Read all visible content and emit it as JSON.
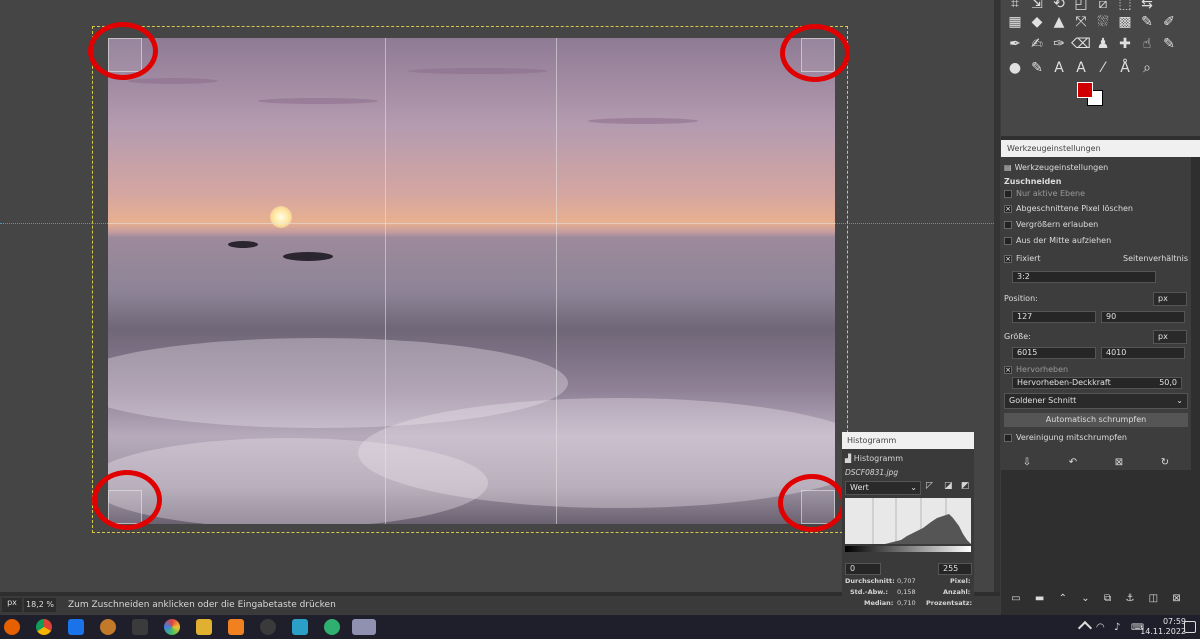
{
  "statusbar": {
    "unit": "px",
    "zoom": "18,2 %",
    "message": "Zum Zuschneiden anklicken oder die Eingabetaste drücken"
  },
  "tool_options": {
    "window_title": "Werkzeugeinstellungen",
    "tab_label": "Werkzeugeinstellungen",
    "section": "Zuschneiden",
    "only_active_layer": "Nur aktive Ebene",
    "delete_cropped": "Abgeschnittene Pixel löschen",
    "allow_growing": "Vergrößern erlauben",
    "expand_from_center": "Aus der Mitte aufziehen",
    "fixed_label": "Fixiert",
    "fixed_mode": "Seitenverhältnis",
    "ratio_value": "3:2",
    "position_label": "Position:",
    "position_unit": "px",
    "position_x": "127",
    "position_y": "90",
    "size_label": "Größe:",
    "size_unit": "px",
    "size_w": "6015",
    "size_h": "4010",
    "highlight": "Hervorheben",
    "highlight_opacity": "Hervorheben-Deckkraft",
    "highlight_value": "50,0",
    "guides_value": "Goldener Schnitt",
    "auto_shrink": "Automatisch schrumpfen",
    "shrink_merged": "Vereinigung mitschrumpfen"
  },
  "histogram": {
    "window_title": "Histogramm",
    "tab_label": "Histogramm",
    "filename": "DSCF0831.jpg",
    "channel": "Wert",
    "range_min": "0",
    "range_max": "255",
    "mean_label": "Durchschnitt:",
    "mean": "0,707",
    "std_label": "Std.-Abw.:",
    "std": "0,158",
    "median_label": "Median:",
    "median": "0,710",
    "pixels_label": "Pixel:",
    "count_label": "Anzahl:",
    "percent_label": "Prozentsatz:"
  },
  "clock": {
    "time": "07:59",
    "date": "14.11.2022"
  },
  "colors": {
    "foreground": "#d00000",
    "background": "#ffffff",
    "annotation_circle": "#e00000"
  }
}
